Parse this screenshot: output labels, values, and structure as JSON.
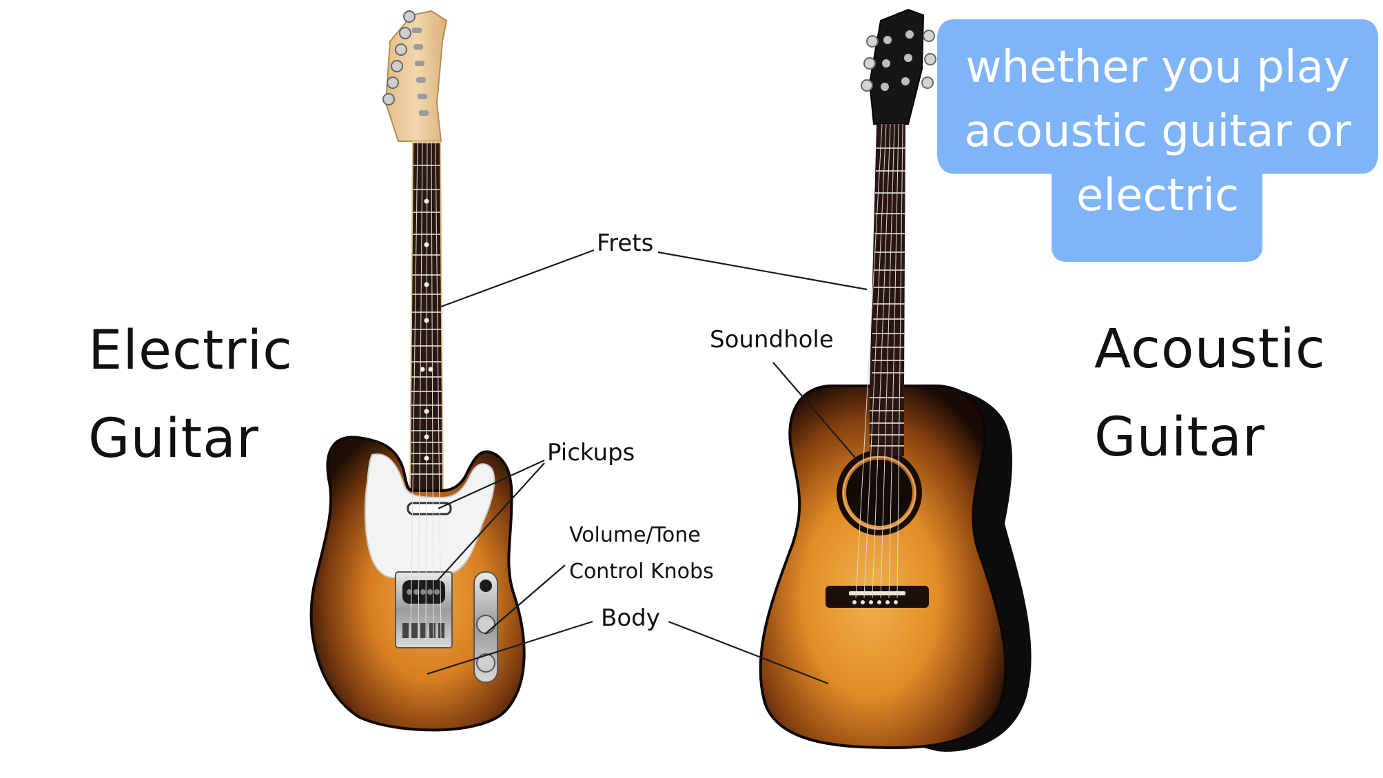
{
  "titles": {
    "electric_line1": "Electric",
    "electric_line2": "Guitar",
    "acoustic_line1": "Acoustic",
    "acoustic_line2": "Guitar"
  },
  "parts": {
    "frets": "Frets",
    "soundhole": "Soundhole",
    "pickups": "Pickups",
    "controls_line1": "Volume/Tone",
    "controls_line2": "Control Knobs",
    "body": "Body"
  },
  "bubble": {
    "line1": "whether you play",
    "line2": "acoustic guitar or",
    "line3": "electric",
    "color": "#80b4f8"
  },
  "colors": {
    "sunburst_center": "#e8a23a",
    "sunburst_edge": "#241106",
    "fretboard": "#2b1812",
    "maple_neck": "#e9c99a",
    "pickguard": "#f4f4f2",
    "label_line": "#1a1a1a"
  }
}
